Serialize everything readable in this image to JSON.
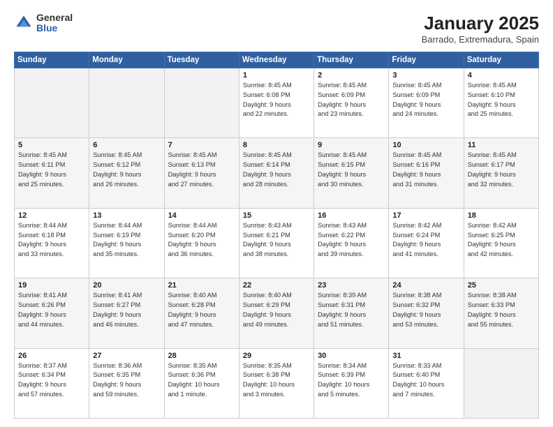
{
  "logo": {
    "general": "General",
    "blue": "Blue"
  },
  "header": {
    "title": "January 2025",
    "subtitle": "Barrado, Extremadura, Spain"
  },
  "weekdays": [
    "Sunday",
    "Monday",
    "Tuesday",
    "Wednesday",
    "Thursday",
    "Friday",
    "Saturday"
  ],
  "weeks": [
    [
      {
        "day": "",
        "info": ""
      },
      {
        "day": "",
        "info": ""
      },
      {
        "day": "",
        "info": ""
      },
      {
        "day": "1",
        "info": "Sunrise: 8:45 AM\nSunset: 6:08 PM\nDaylight: 9 hours\nand 22 minutes."
      },
      {
        "day": "2",
        "info": "Sunrise: 8:45 AM\nSunset: 6:09 PM\nDaylight: 9 hours\nand 23 minutes."
      },
      {
        "day": "3",
        "info": "Sunrise: 8:45 AM\nSunset: 6:09 PM\nDaylight: 9 hours\nand 24 minutes."
      },
      {
        "day": "4",
        "info": "Sunrise: 8:45 AM\nSunset: 6:10 PM\nDaylight: 9 hours\nand 25 minutes."
      }
    ],
    [
      {
        "day": "5",
        "info": "Sunrise: 8:45 AM\nSunset: 6:11 PM\nDaylight: 9 hours\nand 25 minutes."
      },
      {
        "day": "6",
        "info": "Sunrise: 8:45 AM\nSunset: 6:12 PM\nDaylight: 9 hours\nand 26 minutes."
      },
      {
        "day": "7",
        "info": "Sunrise: 8:45 AM\nSunset: 6:13 PM\nDaylight: 9 hours\nand 27 minutes."
      },
      {
        "day": "8",
        "info": "Sunrise: 8:45 AM\nSunset: 6:14 PM\nDaylight: 9 hours\nand 28 minutes."
      },
      {
        "day": "9",
        "info": "Sunrise: 8:45 AM\nSunset: 6:15 PM\nDaylight: 9 hours\nand 30 minutes."
      },
      {
        "day": "10",
        "info": "Sunrise: 8:45 AM\nSunset: 6:16 PM\nDaylight: 9 hours\nand 31 minutes."
      },
      {
        "day": "11",
        "info": "Sunrise: 8:45 AM\nSunset: 6:17 PM\nDaylight: 9 hours\nand 32 minutes."
      }
    ],
    [
      {
        "day": "12",
        "info": "Sunrise: 8:44 AM\nSunset: 6:18 PM\nDaylight: 9 hours\nand 33 minutes."
      },
      {
        "day": "13",
        "info": "Sunrise: 8:44 AM\nSunset: 6:19 PM\nDaylight: 9 hours\nand 35 minutes."
      },
      {
        "day": "14",
        "info": "Sunrise: 8:44 AM\nSunset: 6:20 PM\nDaylight: 9 hours\nand 36 minutes."
      },
      {
        "day": "15",
        "info": "Sunrise: 8:43 AM\nSunset: 6:21 PM\nDaylight: 9 hours\nand 38 minutes."
      },
      {
        "day": "16",
        "info": "Sunrise: 8:43 AM\nSunset: 6:22 PM\nDaylight: 9 hours\nand 39 minutes."
      },
      {
        "day": "17",
        "info": "Sunrise: 8:42 AM\nSunset: 6:24 PM\nDaylight: 9 hours\nand 41 minutes."
      },
      {
        "day": "18",
        "info": "Sunrise: 8:42 AM\nSunset: 6:25 PM\nDaylight: 9 hours\nand 42 minutes."
      }
    ],
    [
      {
        "day": "19",
        "info": "Sunrise: 8:41 AM\nSunset: 6:26 PM\nDaylight: 9 hours\nand 44 minutes."
      },
      {
        "day": "20",
        "info": "Sunrise: 8:41 AM\nSunset: 6:27 PM\nDaylight: 9 hours\nand 46 minutes."
      },
      {
        "day": "21",
        "info": "Sunrise: 8:40 AM\nSunset: 6:28 PM\nDaylight: 9 hours\nand 47 minutes."
      },
      {
        "day": "22",
        "info": "Sunrise: 8:40 AM\nSunset: 6:29 PM\nDaylight: 9 hours\nand 49 minutes."
      },
      {
        "day": "23",
        "info": "Sunrise: 8:39 AM\nSunset: 6:31 PM\nDaylight: 9 hours\nand 51 minutes."
      },
      {
        "day": "24",
        "info": "Sunrise: 8:38 AM\nSunset: 6:32 PM\nDaylight: 9 hours\nand 53 minutes."
      },
      {
        "day": "25",
        "info": "Sunrise: 8:38 AM\nSunset: 6:33 PM\nDaylight: 9 hours\nand 55 minutes."
      }
    ],
    [
      {
        "day": "26",
        "info": "Sunrise: 8:37 AM\nSunset: 6:34 PM\nDaylight: 9 hours\nand 57 minutes."
      },
      {
        "day": "27",
        "info": "Sunrise: 8:36 AM\nSunset: 6:35 PM\nDaylight: 9 hours\nand 59 minutes."
      },
      {
        "day": "28",
        "info": "Sunrise: 8:35 AM\nSunset: 6:36 PM\nDaylight: 10 hours\nand 1 minute."
      },
      {
        "day": "29",
        "info": "Sunrise: 8:35 AM\nSunset: 6:38 PM\nDaylight: 10 hours\nand 3 minutes."
      },
      {
        "day": "30",
        "info": "Sunrise: 8:34 AM\nSunset: 6:39 PM\nDaylight: 10 hours\nand 5 minutes."
      },
      {
        "day": "31",
        "info": "Sunrise: 8:33 AM\nSunset: 6:40 PM\nDaylight: 10 hours\nand 7 minutes."
      },
      {
        "day": "",
        "info": ""
      }
    ]
  ]
}
